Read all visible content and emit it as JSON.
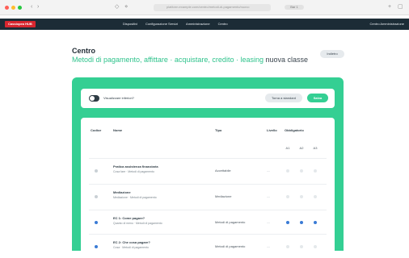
{
  "browser": {
    "url": "platform.example.com/centro/metodi-di-pagamento/nuovo",
    "tab": "Bar 1",
    "dot_colors": [
      "#ff5f57",
      "#febc2e",
      "#28c840"
    ]
  },
  "topnav": {
    "logo": "Cassiopea HUB",
    "menu": [
      "Dispositivi",
      "Configurazione Servizi",
      "Amministrazione",
      "Centro"
    ],
    "right": "Centro Amministrazione"
  },
  "header": {
    "title": "Centro",
    "breadcrumb_part": "Metodi di pagamento, affittare · acquistare, credito · leasing",
    "breadcrumb_current": "nuova classe",
    "action_button": "Indietro"
  },
  "toggle_card": {
    "label": "Visualizzare inferiori?",
    "enabled": true,
    "secondary_button": "Torna a standard",
    "primary_button": "Salva"
  },
  "table": {
    "columns": [
      "Codice",
      "Nome",
      "Tipo",
      "Livello",
      "Obbligatorio"
    ],
    "sub_columns": [
      "A1",
      "A2",
      "A3"
    ],
    "rows": [
      {
        "name": "Pratica assistenza finanziaria",
        "sub": "Cosa fare · Metodi di pagamento",
        "tipo": "Accettabile",
        "level": "—",
        "checked": false,
        "flags": [
          false,
          false,
          false
        ]
      },
      {
        "name": "Mediazione",
        "sub": "Mediazione · Metodi di pagamento",
        "tipo": "Mediazione",
        "level": "—",
        "checked": false,
        "flags": [
          false,
          false,
          false
        ]
      },
      {
        "name": "EC 1: Come pagare?",
        "sub": "Quanto di meno · Metodi di pagamento",
        "tipo": "Metodi di pagamento",
        "level": "—",
        "checked": true,
        "flags": [
          true,
          true,
          true
        ]
      },
      {
        "name": "EC 2: Che cosa pagare?",
        "sub": "Cosa · Metodi di pagamento",
        "tipo": "Metodi di pagamento",
        "level": "—",
        "checked": true,
        "flags": [
          false,
          false,
          false
        ]
      }
    ]
  }
}
